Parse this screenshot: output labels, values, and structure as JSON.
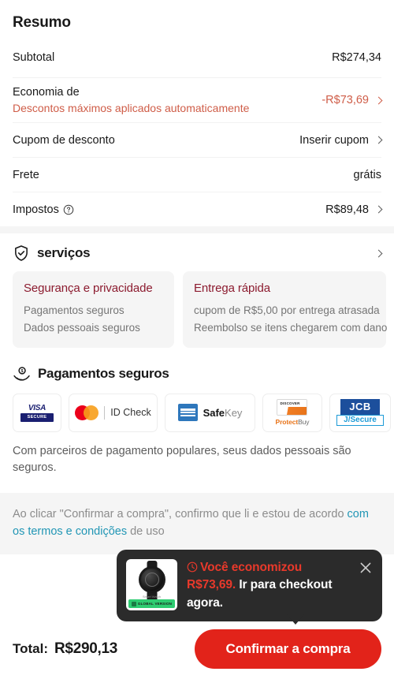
{
  "summary": {
    "title": "Resumo",
    "rows": [
      {
        "label": "Subtotal",
        "value": "R$274,34"
      },
      {
        "label": "Economia de",
        "note": "Descontos máximos aplicados automaticamente",
        "value": "-R$73,69"
      },
      {
        "label": "Cupom de desconto",
        "value": "Inserir cupom"
      },
      {
        "label": "Frete",
        "value": "grátis"
      },
      {
        "label": "Impostos",
        "value": "R$89,48"
      }
    ]
  },
  "services": {
    "title": "serviços",
    "icon": "shield-check-icon",
    "cards": [
      {
        "title": "Segurança e privacidade",
        "lines": [
          "Pagamentos seguros",
          "Dados pessoais seguros"
        ]
      },
      {
        "title": "Entrega rápida",
        "lines": [
          "cupom de R$5,00 por entrega atrasada",
          "Reembolso se itens chegarem com dano"
        ]
      }
    ]
  },
  "payments": {
    "title": "Pagamentos seguros",
    "icon": "hand-coin-icon",
    "logos": [
      {
        "name": "visa-secure-logo",
        "brand": "VISA",
        "sub": "SECURE"
      },
      {
        "name": "mastercard-idcheck-logo",
        "brand": "",
        "sub": "ID Check"
      },
      {
        "name": "amex-safekey-logo",
        "brand": "Safe",
        "sub": "Key"
      },
      {
        "name": "discover-protectbuy-logo",
        "brand": "DISCOVER",
        "sub": "Protect",
        "sub2": "Buy"
      },
      {
        "name": "jcb-jsecure-logo",
        "brand": "JCB",
        "sub": "J/Secure"
      }
    ],
    "note": "Com parceiros de pagamento populares, seus dados pessoais são seguros."
  },
  "terms": {
    "text_before": "Ao clicar \"Confirmar a compra\", confirmo que li e estou de acordo ",
    "link_text": "com os termos e condições",
    "text_after": " de uso"
  },
  "checkout": {
    "total_label": "Total:",
    "total_value": "R$290,13",
    "confirm_label": "Confirmar a compra"
  },
  "tooltip": {
    "headline": "Você economizou",
    "amount": "R$73,69.",
    "cta": " Ir para checkout agora.",
    "clock_icon": "clock-icon",
    "close_icon": "close-icon",
    "thumb_badge": "GLOBAL VERSION",
    "thumb_caption": "Smart Watch"
  },
  "colors": {
    "accent_red": "#e2231a",
    "discount": "#cf5d48",
    "card_title": "#8c1b2f",
    "link": "#2196b5",
    "tooltip_bg": "#2b2b2b"
  }
}
